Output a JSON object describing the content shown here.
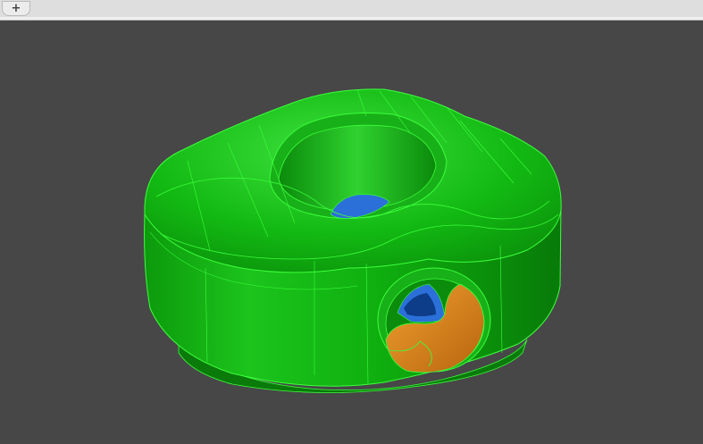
{
  "tabbar": {
    "new_tab_label": "+"
  },
  "viewport": {
    "background_color": "#474747",
    "model": {
      "body_color": "#1ec41e",
      "edge_color": "#3cff3c",
      "inner_hole_color": "#2b6fd8",
      "cavity_color": "#d8841c"
    }
  }
}
